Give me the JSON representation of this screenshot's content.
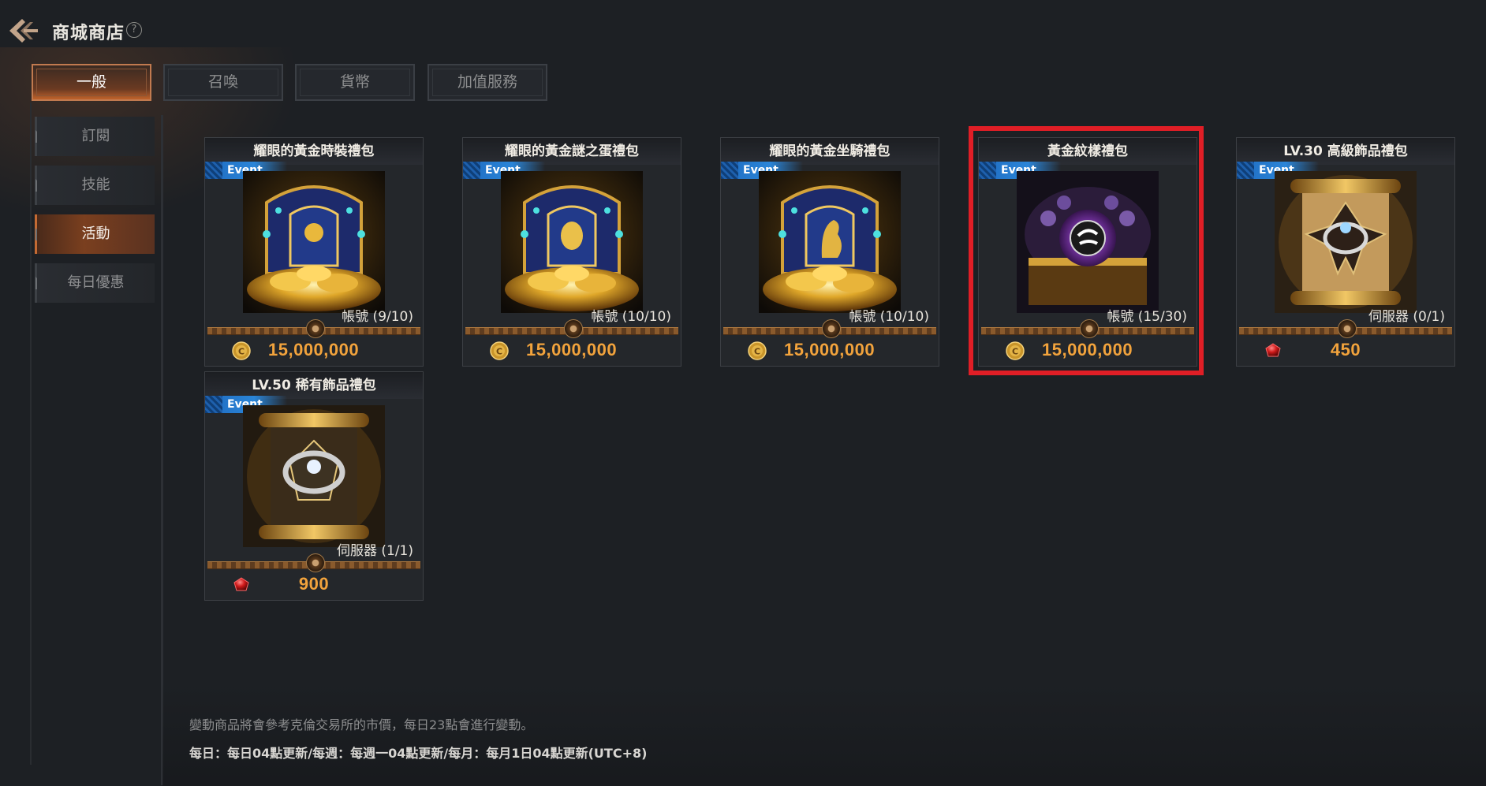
{
  "header": {
    "title": "商城商店",
    "help_icon": "?"
  },
  "tabs": [
    {
      "label": "一般",
      "active": true
    },
    {
      "label": "召喚",
      "active": false
    },
    {
      "label": "貨幣",
      "active": false
    },
    {
      "label": "加值服務",
      "active": false
    }
  ],
  "sidebar": {
    "items": [
      {
        "label": "訂閱",
        "active": false
      },
      {
        "label": "技能",
        "active": false
      },
      {
        "label": "活動",
        "active": true
      },
      {
        "label": "每日優惠",
        "active": false
      }
    ]
  },
  "products": [
    {
      "title": "耀眼的黃金時裝禮包",
      "badge": "Event",
      "limit": "帳號 (9/10)",
      "currency": "gold-coin",
      "price": "15,000,000"
    },
    {
      "title": "耀眼的黃金謎之蛋禮包",
      "badge": "Event",
      "limit": "帳號 (10/10)",
      "currency": "gold-coin",
      "price": "15,000,000"
    },
    {
      "title": "耀眼的黃金坐騎禮包",
      "badge": "Event",
      "limit": "帳號 (10/10)",
      "currency": "gold-coin",
      "price": "15,000,000"
    },
    {
      "title": "黃金紋樣禮包",
      "badge": "Event",
      "limit": "帳號 (15/30)",
      "currency": "gold-coin",
      "price": "15,000,000",
      "highlighted": true
    },
    {
      "title": "LV.30 高級飾品禮包",
      "badge": "Event",
      "limit": "伺服器 (0/1)",
      "currency": "red-diamond",
      "price": "450"
    },
    {
      "title": "LV.50 稀有飾品禮包",
      "badge": "Event",
      "limit": "伺服器 (1/1)",
      "currency": "red-diamond",
      "price": "900"
    }
  ],
  "notes": {
    "line1": "變動商品將會參考克倫交易所的市價，每日23點會進行變動。",
    "line2": "每日：每日04點更新/每週：每週一04點更新/每月：每月1日04點更新(UTC+8)"
  },
  "colors": {
    "accent": "#c1632b",
    "price": "#f2a33c",
    "event_badge": "#2a85d8",
    "highlight": "#e01e26"
  }
}
